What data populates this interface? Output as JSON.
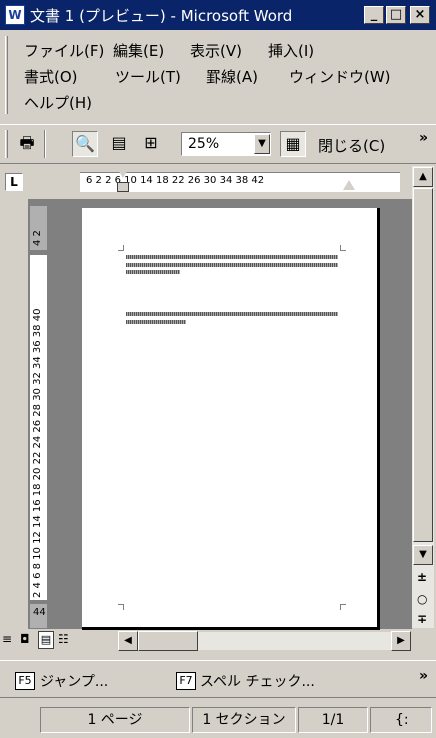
{
  "window": {
    "title": "文書 1 (プレビュー) - Microsoft Word",
    "app_icon_glyph": "W",
    "buttons": {
      "minimize": "_",
      "maximize": "□",
      "close": "×"
    }
  },
  "menu": {
    "items": [
      "ファイル(F)",
      "編集(E)",
      "表示(V)",
      "挿入(I)",
      "書式(O)",
      "ツール(T)",
      "罫線(A)",
      "ウィンドウ(W)",
      "ヘルプ(H)"
    ]
  },
  "toolbar": {
    "zoom_value": "25%",
    "close_label": "閉じる(C)",
    "overflow": "»"
  },
  "ruler": {
    "horizontal_numbers": "6  2  2  6  10  14  18  22  26  30  34  38  42",
    "vertical_top_numbers": "4 2",
    "vertical_numbers": "2 4 6 8 10 12 14 16 18 20 22 24 26 28 30 32 34 36 38 40",
    "vertical_bottom_number": "44",
    "tab_selector": "L"
  },
  "fkeys": [
    {
      "key": "F5",
      "label": "ジャンプ..."
    },
    {
      "key": "F7",
      "label": "スペル チェック..."
    }
  ],
  "fkey_overflow": "»",
  "status": {
    "page": "1 ページ",
    "section": "1 セクション",
    "position": "1/1",
    "extra": "{:"
  }
}
